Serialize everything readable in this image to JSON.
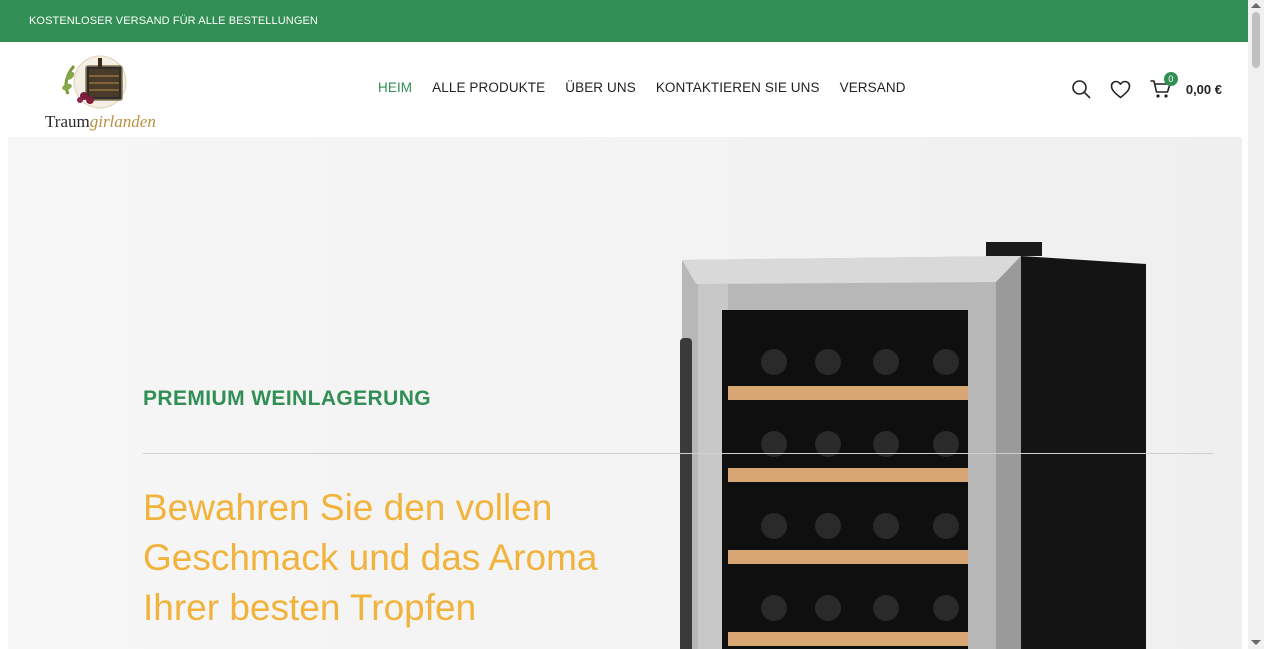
{
  "topbar": {
    "text": "KOSTENLOSER VERSAND FÜR ALLE BESTELLUNGEN"
  },
  "header": {
    "logo_text_main": "Traum",
    "logo_text_accent": "girlanden",
    "nav": [
      {
        "label": "HEIM",
        "active": true
      },
      {
        "label": "ALLE PRODUKTE"
      },
      {
        "label": "ÜBER UNS"
      },
      {
        "label": "KONTAKTIEREN SIE UNS"
      },
      {
        "label": "VERSAND"
      }
    ],
    "cart_count": "0",
    "cart_total": "0,00 €"
  },
  "hero": {
    "eyebrow": "PREMIUM WEINLAGERUNG",
    "headline": "Bewahren Sie den vollen Geschmack und das Aroma Ihrer besten Tropfen"
  },
  "colors": {
    "brand": "#318f55",
    "accent": "#f2b33d"
  },
  "icons": [
    "search-icon",
    "heart-icon",
    "cart-icon"
  ]
}
